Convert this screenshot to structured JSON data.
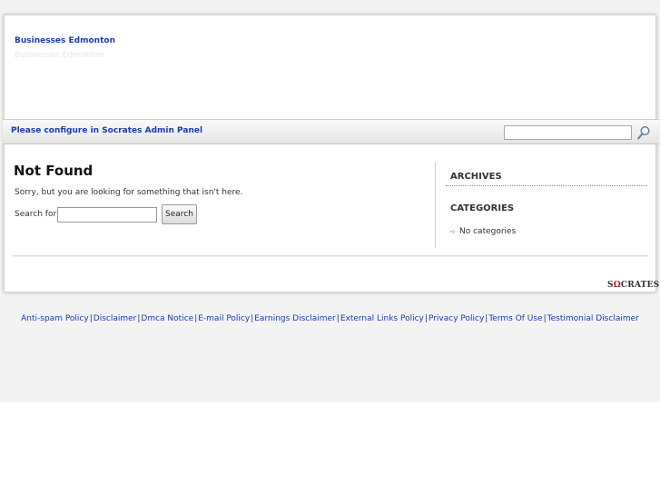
{
  "header": {
    "site_title": "Businesses Edmonton",
    "site_description": "Businesses Edmonton"
  },
  "navbar": {
    "message": "Please configure in Socrates Admin Panel",
    "search_value": "",
    "search_icon": "magnifier-icon"
  },
  "main": {
    "title": "Not Found",
    "message": "Sorry, but you are looking for something that isn't here.",
    "search_label": "Search for:",
    "search_value": "",
    "search_button": "Search"
  },
  "sidebar": {
    "archives_title": "ARCHIVES",
    "categories_title": "CATEGORIES",
    "categories": [
      "No categories"
    ]
  },
  "branding": {
    "logo_prefix": "S",
    "logo_omega": "Ω",
    "logo_suffix": "CRATES",
    "accent_color": "#1a3bb8"
  },
  "footer": {
    "links": [
      "Anti-spam Policy",
      "Disclaimer",
      "Dmca Notice",
      "E-mail Policy",
      "Earnings Disclaimer",
      "External Links Policy",
      "Privacy Policy",
      "Terms Of Use",
      "Testimonial Disclaimer"
    ],
    "separator": "|"
  }
}
